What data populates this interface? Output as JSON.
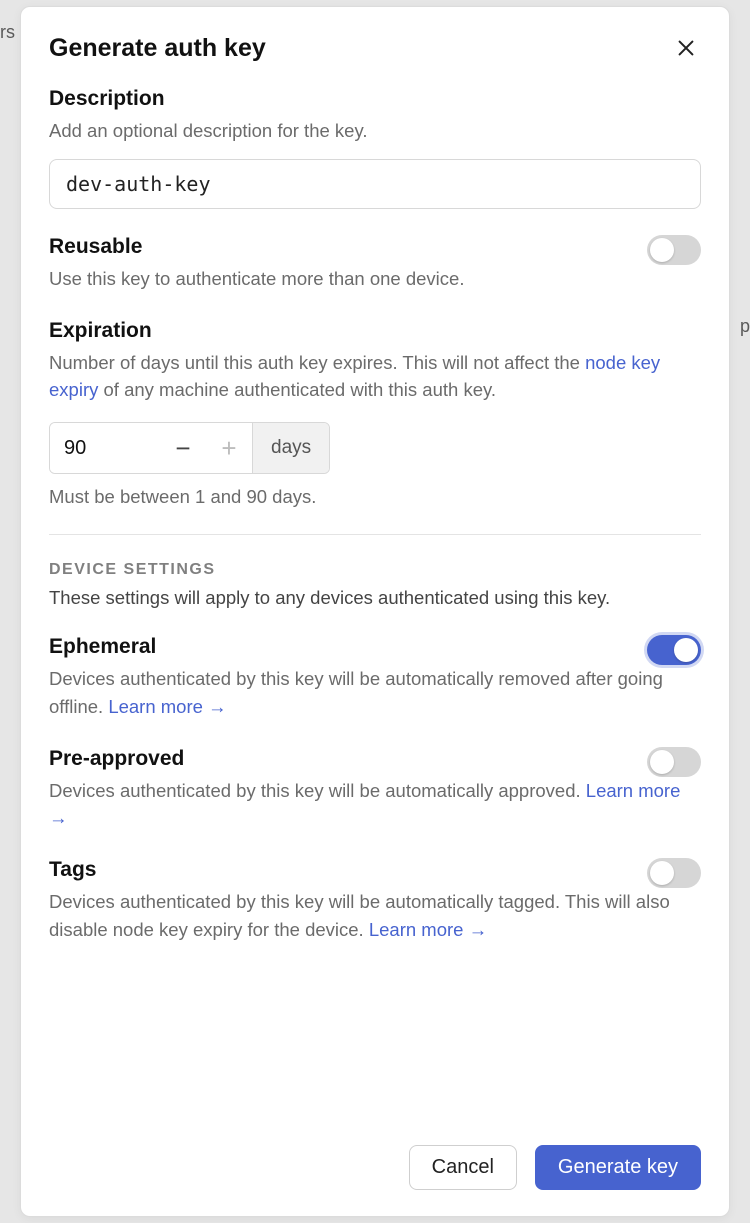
{
  "modal": {
    "title": "Generate auth key",
    "description": {
      "title": "Description",
      "help": "Add an optional description for the key.",
      "value": "dev-auth-key"
    },
    "reusable": {
      "title": "Reusable",
      "help": "Use this key to authenticate more than one device.",
      "on": false
    },
    "expiration": {
      "title": "Expiration",
      "help_a": "Number of days until this auth key expires. This will not affect the ",
      "help_link": "node key expiry",
      "help_b": " of any machine authenticated with this auth key.",
      "value": "90",
      "unit": "days",
      "hint": "Must be between 1 and 90 days."
    },
    "device_settings": {
      "heading": "DEVICE SETTINGS",
      "sub": "These settings will apply to any devices authenticated using this key.",
      "ephemeral": {
        "title": "Ephemeral",
        "help": "Devices authenticated by this key will be automatically removed after going offline. ",
        "learn": "Learn more →",
        "on": true
      },
      "preapproved": {
        "title": "Pre-approved",
        "help": "Devices authenticated by this key will be automatically approved. ",
        "learn": "Learn more →",
        "on": false
      },
      "tags": {
        "title": "Tags",
        "help": "Devices authenticated by this key will be automatically tagged. This will also disable node key expiry for the device. ",
        "learn": "Learn more →",
        "on": false
      }
    },
    "footer": {
      "cancel": "Cancel",
      "submit": "Generate key"
    }
  }
}
